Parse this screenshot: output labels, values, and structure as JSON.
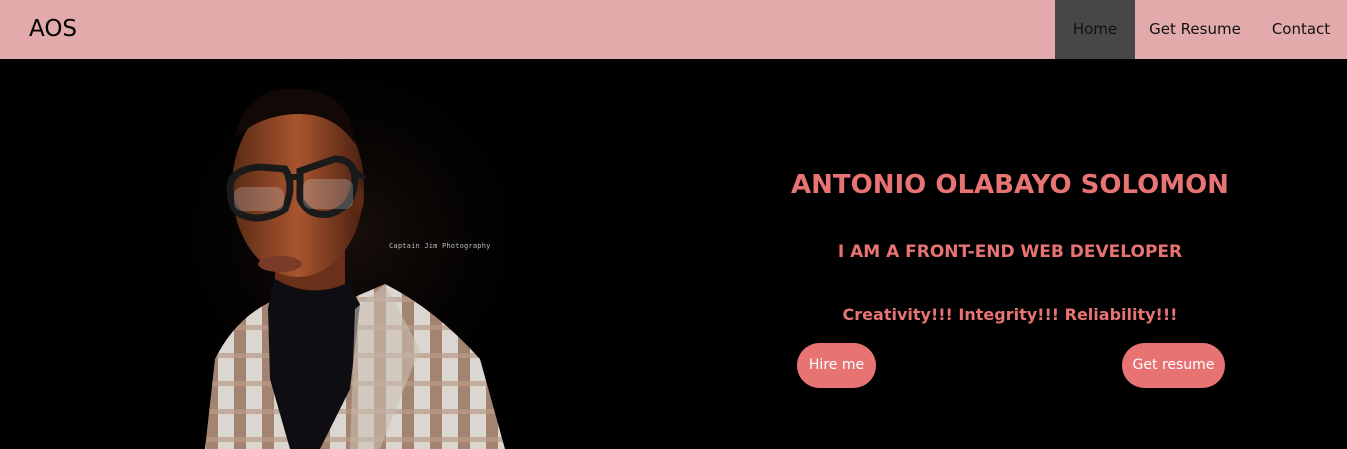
{
  "brand": "AOS",
  "nav": {
    "home": "Home",
    "resume": "Get Resume",
    "contact": "Contact"
  },
  "hero": {
    "name": "ANTONIO OLABAYO SOLOMON",
    "role": "I AM A FRONT-END WEB DEVELOPER",
    "tagline": "Creativity!!! Integrity!!! Reliability!!!",
    "watermark": "Captain Jim Photography",
    "hire_label": "Hire me",
    "resume_label": "Get resume"
  },
  "colors": {
    "navbar": "#e2aaaa",
    "nav_active": "#474747",
    "accent": "#e87373",
    "background": "#000000"
  }
}
